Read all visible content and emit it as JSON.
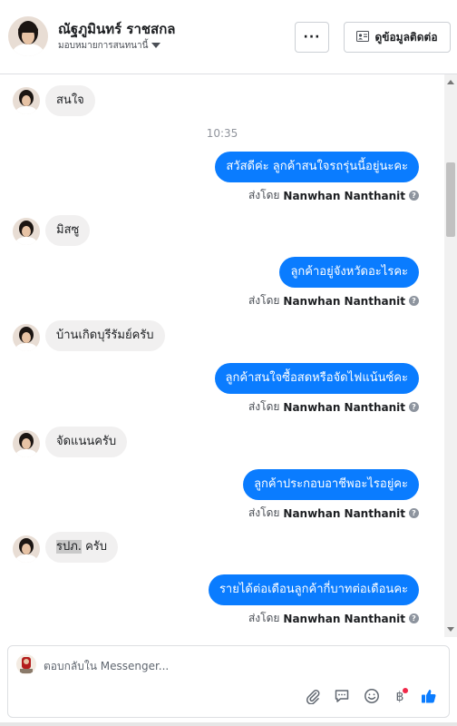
{
  "header": {
    "name": "ณัฐภูมินทร์ ราชสกล",
    "assignment": "มอบหมายการสนทนานี้",
    "more_button": "···",
    "info_button": "ดูข้อมูลติดต่อ"
  },
  "thread": {
    "timestamp": "10:35",
    "messages": [
      {
        "from": "customer",
        "text": "สนใจ"
      },
      {
        "from": "page",
        "text": "สวัสดีค่ะ ลูกค้าสนใจรถรุ่นนี้อยู่นะคะ",
        "sent_by_label": "ส่งโดย",
        "sent_by_name": "Nanwhan Nanthanit"
      },
      {
        "from": "customer",
        "text": "มิสซู"
      },
      {
        "from": "page",
        "text": "ลูกค้าอยู่จังหวัดอะไรคะ",
        "sent_by_label": "ส่งโดย",
        "sent_by_name": "Nanwhan Nanthanit"
      },
      {
        "from": "customer",
        "text": "บ้านเกิดบุรีรัมย์ครับ"
      },
      {
        "from": "page",
        "text": "ลูกค้าสนใจซื้อสดหรือจัดไฟแน้นซ์คะ",
        "sent_by_label": "ส่งโดย",
        "sent_by_name": "Nanwhan Nanthanit"
      },
      {
        "from": "customer",
        "text": "จัดแนนครับ"
      },
      {
        "from": "page",
        "text": "ลูกค้าประกอบอาชีพอะไรอยู่คะ",
        "sent_by_label": "ส่งโดย",
        "sent_by_name": "Nanwhan Nanthanit"
      },
      {
        "from": "customer",
        "text_highlight": "รปภ.",
        "text_rest": " ครับ"
      },
      {
        "from": "page",
        "text": "รายได้ต่อเดือนลูกค้ากี่บาทต่อเดือนคะ",
        "sent_by_label": "ส่งโดย",
        "sent_by_name": "Nanwhan Nanthanit"
      }
    ]
  },
  "composer": {
    "placeholder": "ตอบกลับใน Messenger...",
    "tools": [
      "paperclip-icon",
      "saved-reply-icon",
      "emoji-icon",
      "baht-payment-icon",
      "thumbs-up-icon"
    ],
    "notification_dot_color": "#f02849"
  },
  "colors": {
    "outgoing_bubble": "#0a7cff",
    "incoming_bubble": "#f1f0f0"
  }
}
